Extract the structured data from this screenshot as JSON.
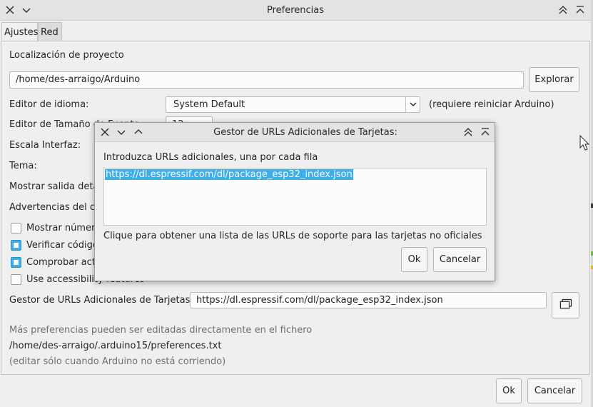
{
  "window": {
    "title": "Preferencias",
    "tabs": [
      {
        "label": "Ajustes"
      },
      {
        "label": "Red"
      }
    ]
  },
  "settings": {
    "project_location_label": "Localización de proyecto",
    "project_location_value": "/home/des-arraigo/Arduino",
    "browse_button": "Explorar",
    "language_label": "Editor de idioma:",
    "language_value": "System Default",
    "language_note": "(requiere reiniciar Arduino)",
    "font_size_label": "Editor de Tamaño de Fuente:",
    "font_size_value": "12",
    "scale_label": "Escala Interfaz:",
    "theme_label": "Tema:",
    "verbose_label": "Mostrar salida detallada mientras:",
    "warnings_label": "Advertencias del compilador:",
    "checkboxes": [
      {
        "label": "Mostrar números de línea",
        "checked": false
      },
      {
        "label": "Verificar código después de subir",
        "checked": true
      },
      {
        "label": "Comprobar actualizaciones al iniciar",
        "checked": true
      },
      {
        "label": "Use accessibility features",
        "checked": false
      }
    ],
    "boards_url_label": "Gestor de URLs Adicionales de Tarjetas:",
    "boards_url_value": "https://dl.espressif.com/dl/package_esp32_index.json",
    "more_prefs_note": "Más preferencias pueden ser editadas directamente en el fichero",
    "prefs_path": "/home/des-arraigo/.arduino15/preferences.txt",
    "edit_note": "(editar sólo cuando Arduino no está corriendo)",
    "ok_button": "Ok",
    "cancel_button": "Cancelar"
  },
  "dialog": {
    "title": "Gestor de URLs Adicionales de Tarjetas:",
    "instruction": "Introduzca URLs adicionales, una por cada fila",
    "urls_text": "https://dl.espressif.com/dl/package_esp32_index.json",
    "help_link": "Clique para obtener una lista de las URLs de soporte para las tarjetas no oficiales",
    "ok_button": "Ok",
    "cancel_button": "Cancelar"
  },
  "colors": {
    "selection": "#3daee9",
    "window_bg": "#efefef"
  }
}
